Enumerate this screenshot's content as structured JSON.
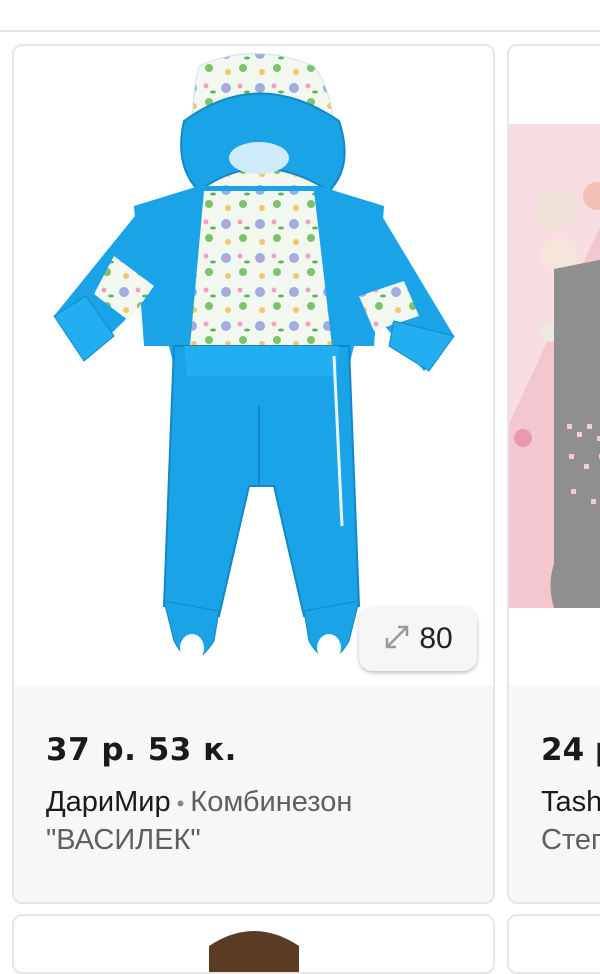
{
  "products": [
    {
      "price": "37 р. 53 к.",
      "shop": "ДариМир",
      "separator": "•",
      "title_line1": "Комбинезон",
      "title_line2": "\"ВАСИЛЕК\"",
      "photo_count": "80",
      "image": "blue winter baby jumpsuit with floral print",
      "zoom_icon": "expand-arrows-icon"
    },
    {
      "price": "24 р",
      "shop": "Tash",
      "title_line2": "Стег",
      "image": "grey knitted item on pink background"
    }
  ],
  "colors": {
    "jumpsuit_blue": "#1aa3e6",
    "price_text": "#1a1a1a",
    "secondary_text": "#5f5f5f",
    "card_border": "#e6e6e6"
  }
}
